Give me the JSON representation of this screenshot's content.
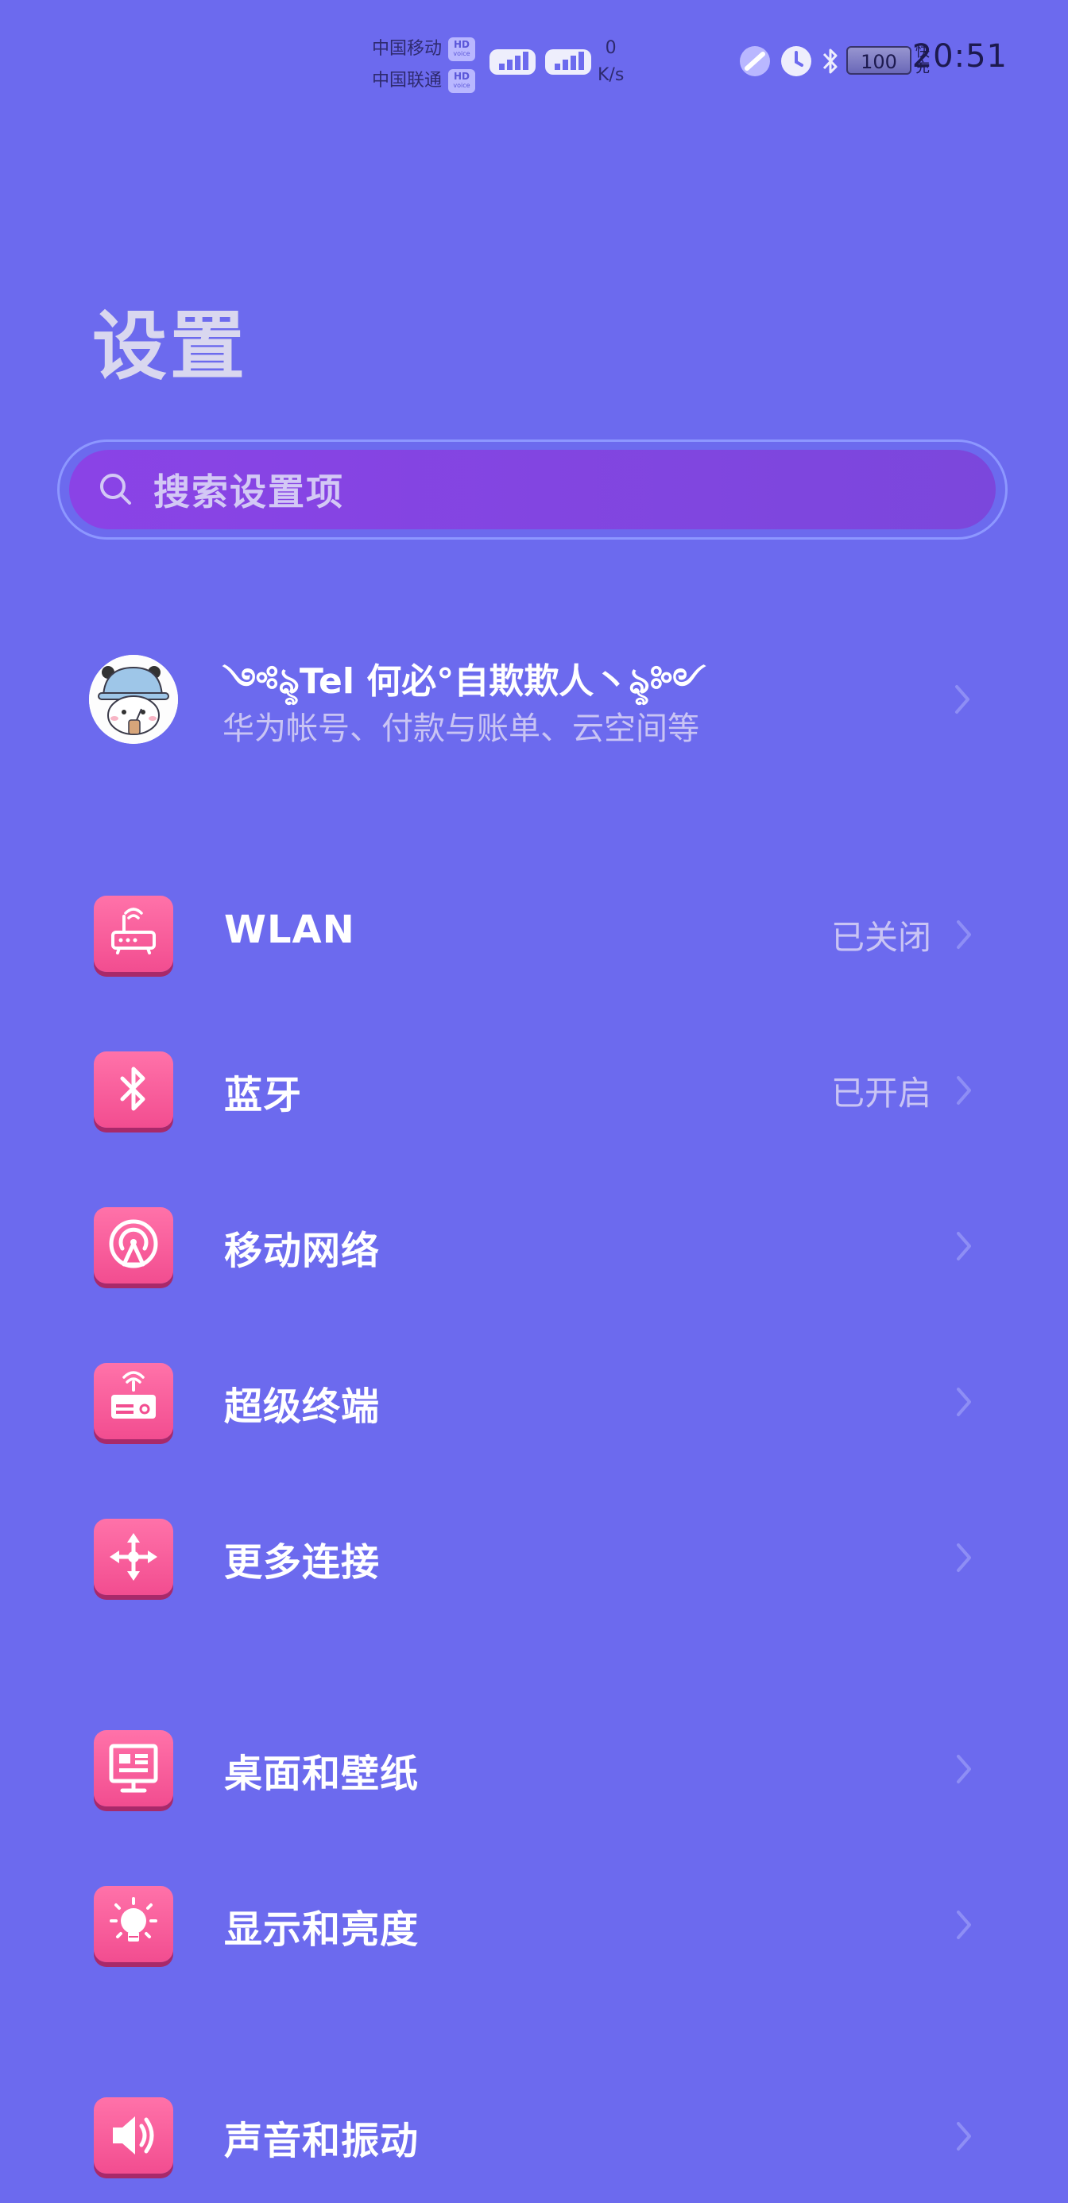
{
  "status_bar": {
    "carrier1": "中国移动",
    "carrier2": "中国联通",
    "hd_label": "HD",
    "hd_sub": "voice",
    "net_speed_value": "0",
    "net_speed_unit": "K/s",
    "battery": "100",
    "charge_label": "快充",
    "time": "20:51"
  },
  "page": {
    "title": "设置"
  },
  "search": {
    "placeholder": "搜索设置项"
  },
  "account": {
    "name": "༺ৡTel 何必°自欺欺人丶ৡ༻",
    "subtitle": "华为帐号、付款与账单、云空间等"
  },
  "settings": [
    {
      "label": "WLAN",
      "value": "已关闭",
      "icon": "router-icon"
    },
    {
      "label": "蓝牙",
      "value": "已开启",
      "icon": "bluetooth-icon"
    },
    {
      "label": "移动网络",
      "value": "",
      "icon": "antenna-icon"
    },
    {
      "label": "超级终端",
      "value": "",
      "icon": "super-device-icon"
    },
    {
      "label": "更多连接",
      "value": "",
      "icon": "move-arrows-icon"
    },
    {
      "label": "桌面和壁纸",
      "value": "",
      "icon": "desktop-icon"
    },
    {
      "label": "显示和亮度",
      "value": "",
      "icon": "bulb-icon"
    },
    {
      "label": "声音和振动",
      "value": "",
      "icon": "speaker-icon"
    }
  ],
  "colors": {
    "background": "#6c6aee",
    "icon_bg": "#f24d90",
    "search_bg": "#8a43e6"
  }
}
